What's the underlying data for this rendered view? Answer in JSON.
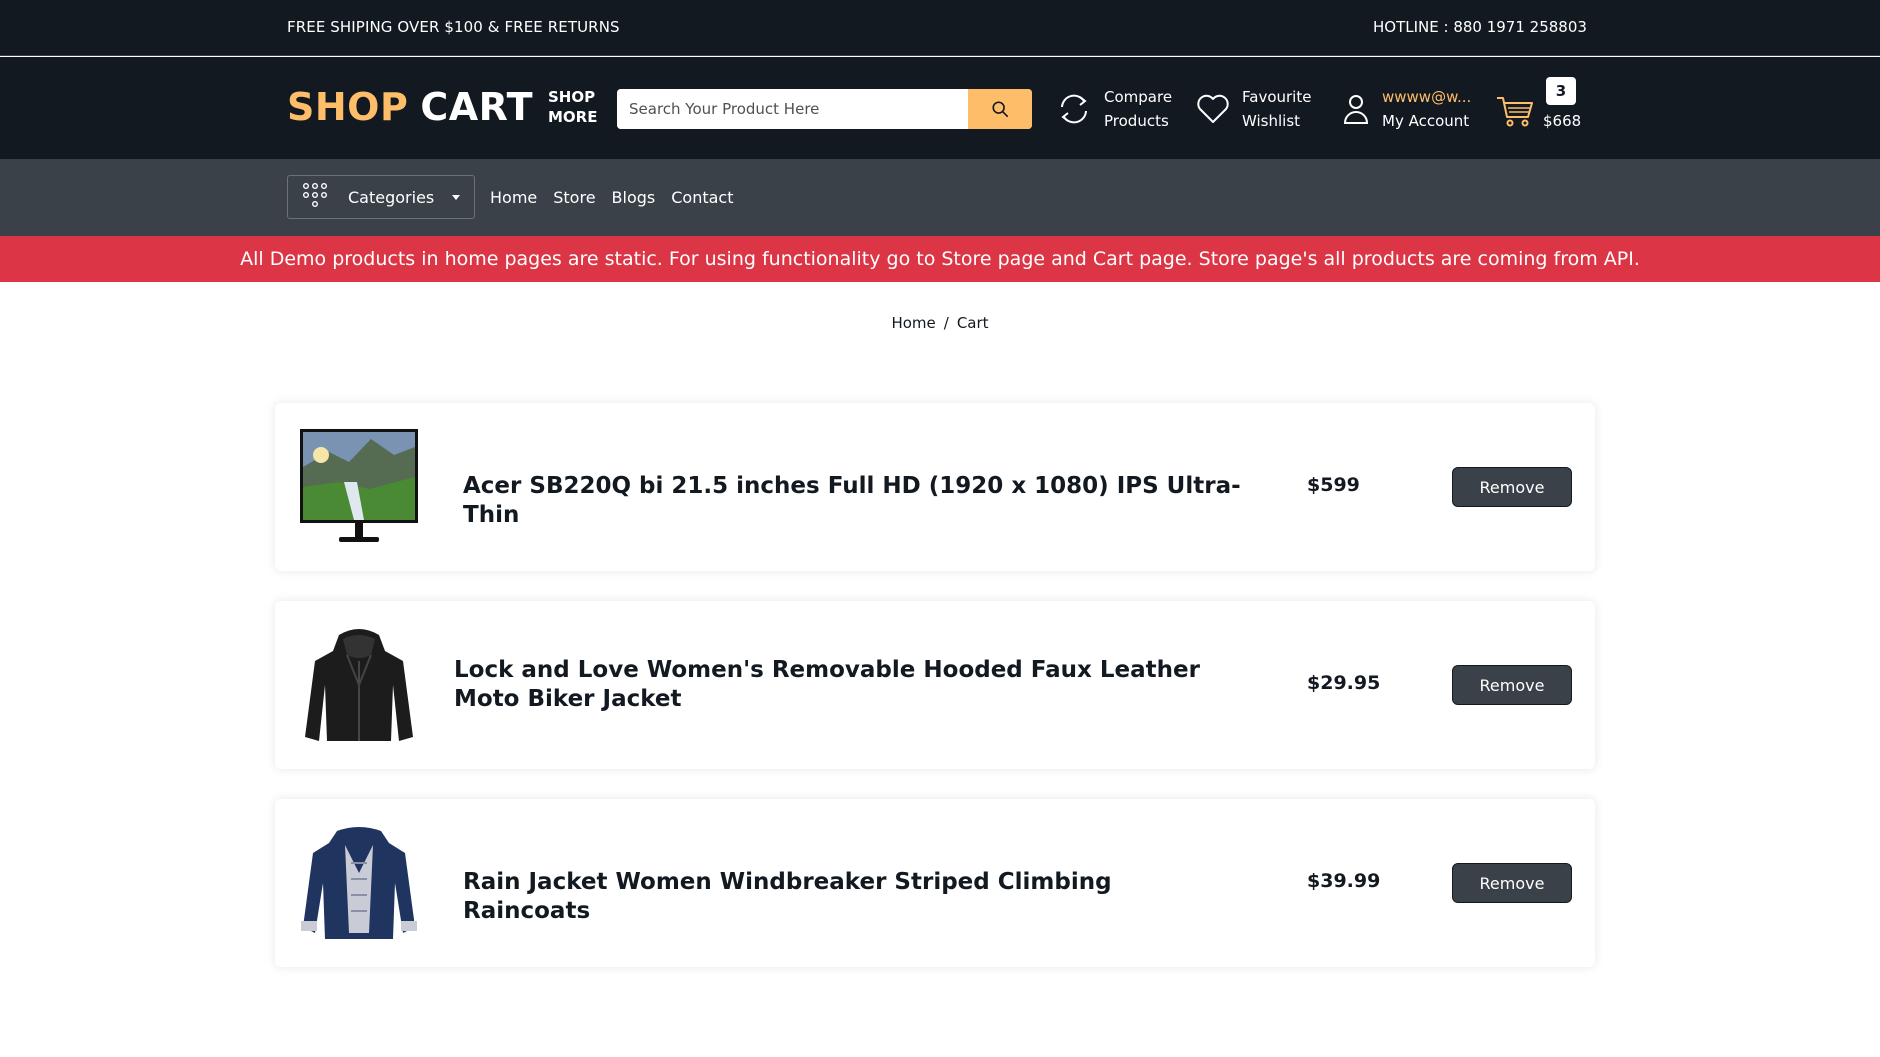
{
  "topbar": {
    "left_text": "FREE SHIPING OVER $100 & FREE RETURNS",
    "hotline": "HOTLINE : 880 1971 258803"
  },
  "header": {
    "logo_part1": "SHOP",
    "logo_part2": "CART",
    "shop_more_line1": "SHOP",
    "shop_more_line2": "MORE",
    "search_placeholder": "Search Your Product Here",
    "compare_line1": "Compare",
    "compare_line2": "Products",
    "wishlist_line1": "Favourite",
    "wishlist_line2": "Wishlist",
    "account_email": "wwww@w...",
    "account_label": "My Account",
    "cart_count": "3",
    "cart_total": "$668",
    "accent_color": "#febd69"
  },
  "nav": {
    "categories_label": "Categories",
    "links": [
      "Home",
      "Store",
      "Blogs",
      "Contact"
    ]
  },
  "notice": {
    "text": "All Demo products in home pages are static. For using functionality go to Store page and Cart page. Store page's all products are coming from API.",
    "color": "#dc3545"
  },
  "breadcrumb": {
    "home": "Home",
    "separator": "/",
    "current": "Cart"
  },
  "cart_items": [
    {
      "title": "Acer SB220Q bi 21.5 inches Full HD (1920 x 1080) IPS Ultra-Thin",
      "price": "$599",
      "remove_label": "Remove",
      "image_icon": "monitor-icon"
    },
    {
      "title": "Lock and Love Women's Removable Hooded Faux Leather Moto Biker Jacket",
      "price": "$29.95",
      "remove_label": "Remove",
      "image_icon": "leather-jacket-icon"
    },
    {
      "title": "Rain Jacket Women Windbreaker Striped Climbing Raincoats",
      "price": "$39.99",
      "remove_label": "Remove",
      "image_icon": "rain-jacket-icon"
    }
  ]
}
